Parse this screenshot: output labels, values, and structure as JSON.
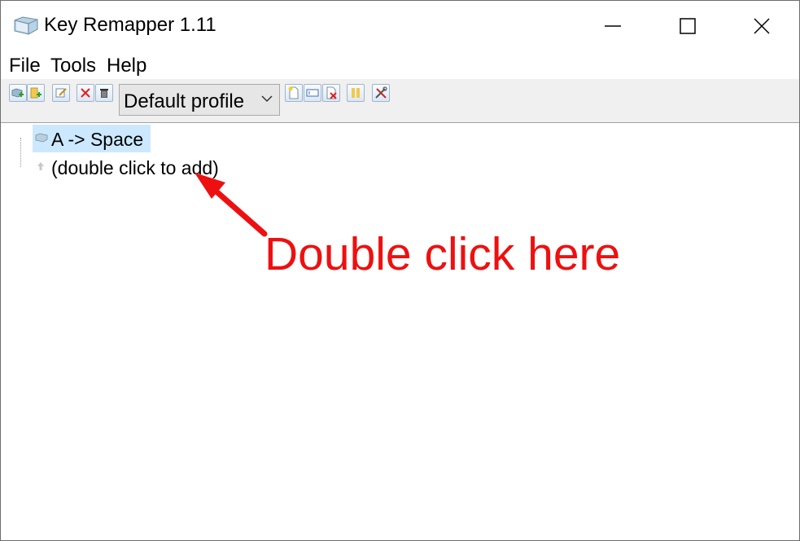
{
  "window": {
    "title": "Key Remapper 1.11",
    "app_icon": "keyboard-key-icon",
    "controls": [
      "minimize-icon",
      "maximize-icon",
      "close-icon"
    ]
  },
  "menu": {
    "file": "File",
    "tools": "Tools",
    "help": "Help"
  },
  "toolbar": {
    "buttons": [
      "add-remap-icon",
      "add-folder-icon",
      "edit-icon",
      "delete-icon",
      "trash-icon",
      "new-profile-icon",
      "rename-profile-icon",
      "delete-profile-icon",
      "pause-icon",
      "settings-tools-icon"
    ],
    "profile_selected": "Default profile"
  },
  "tree": {
    "items": [
      {
        "label": "A -> Space",
        "icon": "key-icon",
        "selected": true
      },
      {
        "label": "(double click to add)",
        "icon": "add-arrow-icon",
        "selected": false
      }
    ]
  },
  "annotation": {
    "text": "Double click here",
    "color": "#ee1010"
  },
  "colors": {
    "selection": "#cce8ff",
    "toolbar_bg": "#f0f0f0"
  }
}
